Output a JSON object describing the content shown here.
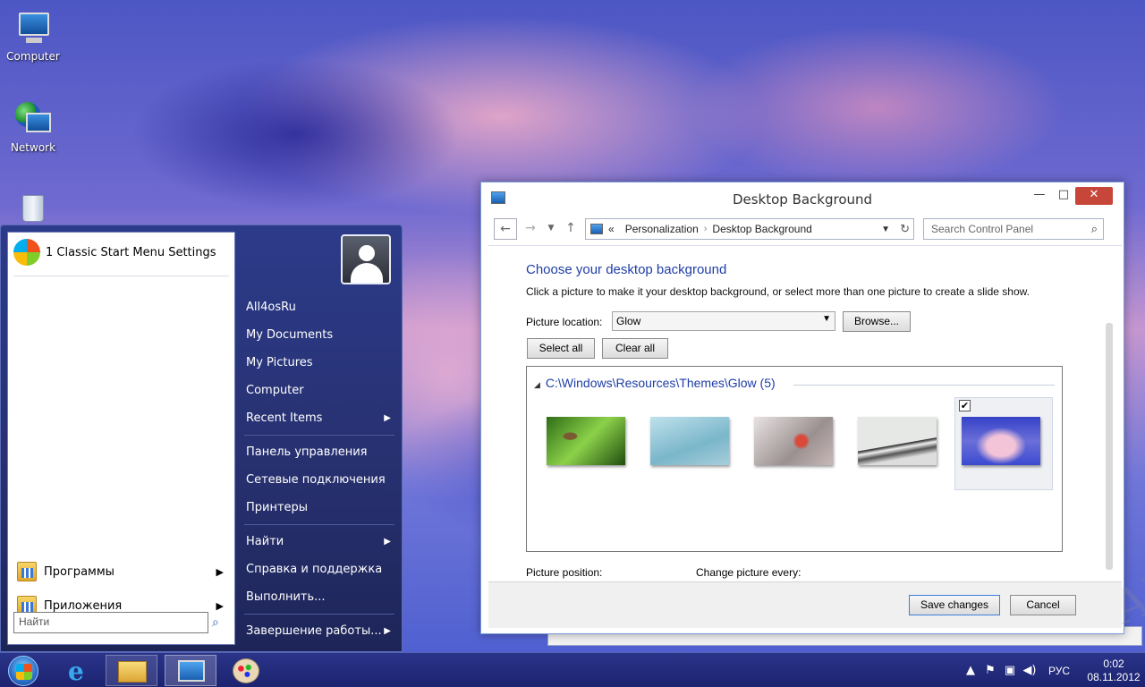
{
  "desktop": {
    "icons": [
      {
        "label": "Computer"
      },
      {
        "label": "Network"
      },
      {
        "label": "Recycle Bin"
      }
    ]
  },
  "start_menu": {
    "pinned_item": "1 Classic Start Menu Settings",
    "bottom_items": [
      {
        "label": "Программы",
        "arrow": "▶"
      },
      {
        "label": "Приложения",
        "arrow": "▶"
      }
    ],
    "search_placeholder": "Найти",
    "right_items_group1": [
      {
        "label": "All4osRu"
      },
      {
        "label": "My Documents"
      },
      {
        "label": "My Pictures"
      },
      {
        "label": "Computer"
      },
      {
        "label": "Recent Items",
        "arrow": "▶"
      }
    ],
    "right_items_group2": [
      {
        "label": "Панель управления"
      },
      {
        "label": "Сетевые подключения"
      },
      {
        "label": "Принтеры"
      }
    ],
    "right_items_group3": [
      {
        "label": "Найти",
        "arrow": "▶"
      },
      {
        "label": "Справка и поддержка"
      },
      {
        "label": "Выполнить..."
      }
    ],
    "shutdown": {
      "label": "Завершение работы...",
      "arrow": "▶"
    }
  },
  "window": {
    "title": "Desktop Background",
    "controls": {
      "minimize": "—",
      "maximize": "□",
      "close": "✕"
    },
    "breadcrumb": {
      "prefix": "«",
      "items": [
        "Personalization",
        "Desktop Background"
      ]
    },
    "search_placeholder": "Search Control Panel",
    "heading": "Choose your desktop background",
    "subtext": "Click a picture to make it your desktop background, or select more than one picture to create a slide show.",
    "picture_location_label": "Picture location:",
    "picture_location_value": "Glow",
    "browse_button": "Browse...",
    "select_all_button": "Select all",
    "clear_all_button": "Clear all",
    "group_header": "C:\\Windows\\Resources\\Themes\\Glow (5)",
    "thumbnails": [
      {
        "name": "grasshopper-on-leaf",
        "selected": false
      },
      {
        "name": "blue-water-drops",
        "selected": false
      },
      {
        "name": "red-berries",
        "selected": false
      },
      {
        "name": "white-architecture",
        "selected": false
      },
      {
        "name": "pink-clouds-sky",
        "selected": true
      }
    ],
    "picture_position_label": "Picture position:",
    "change_picture_label": "Change picture every:",
    "save_button": "Save changes",
    "cancel_button": "Cancel",
    "watermark": "All4os.RU"
  },
  "taskbar": {
    "language": "РУС",
    "time": "0:02",
    "date": "08.11.2012"
  }
}
